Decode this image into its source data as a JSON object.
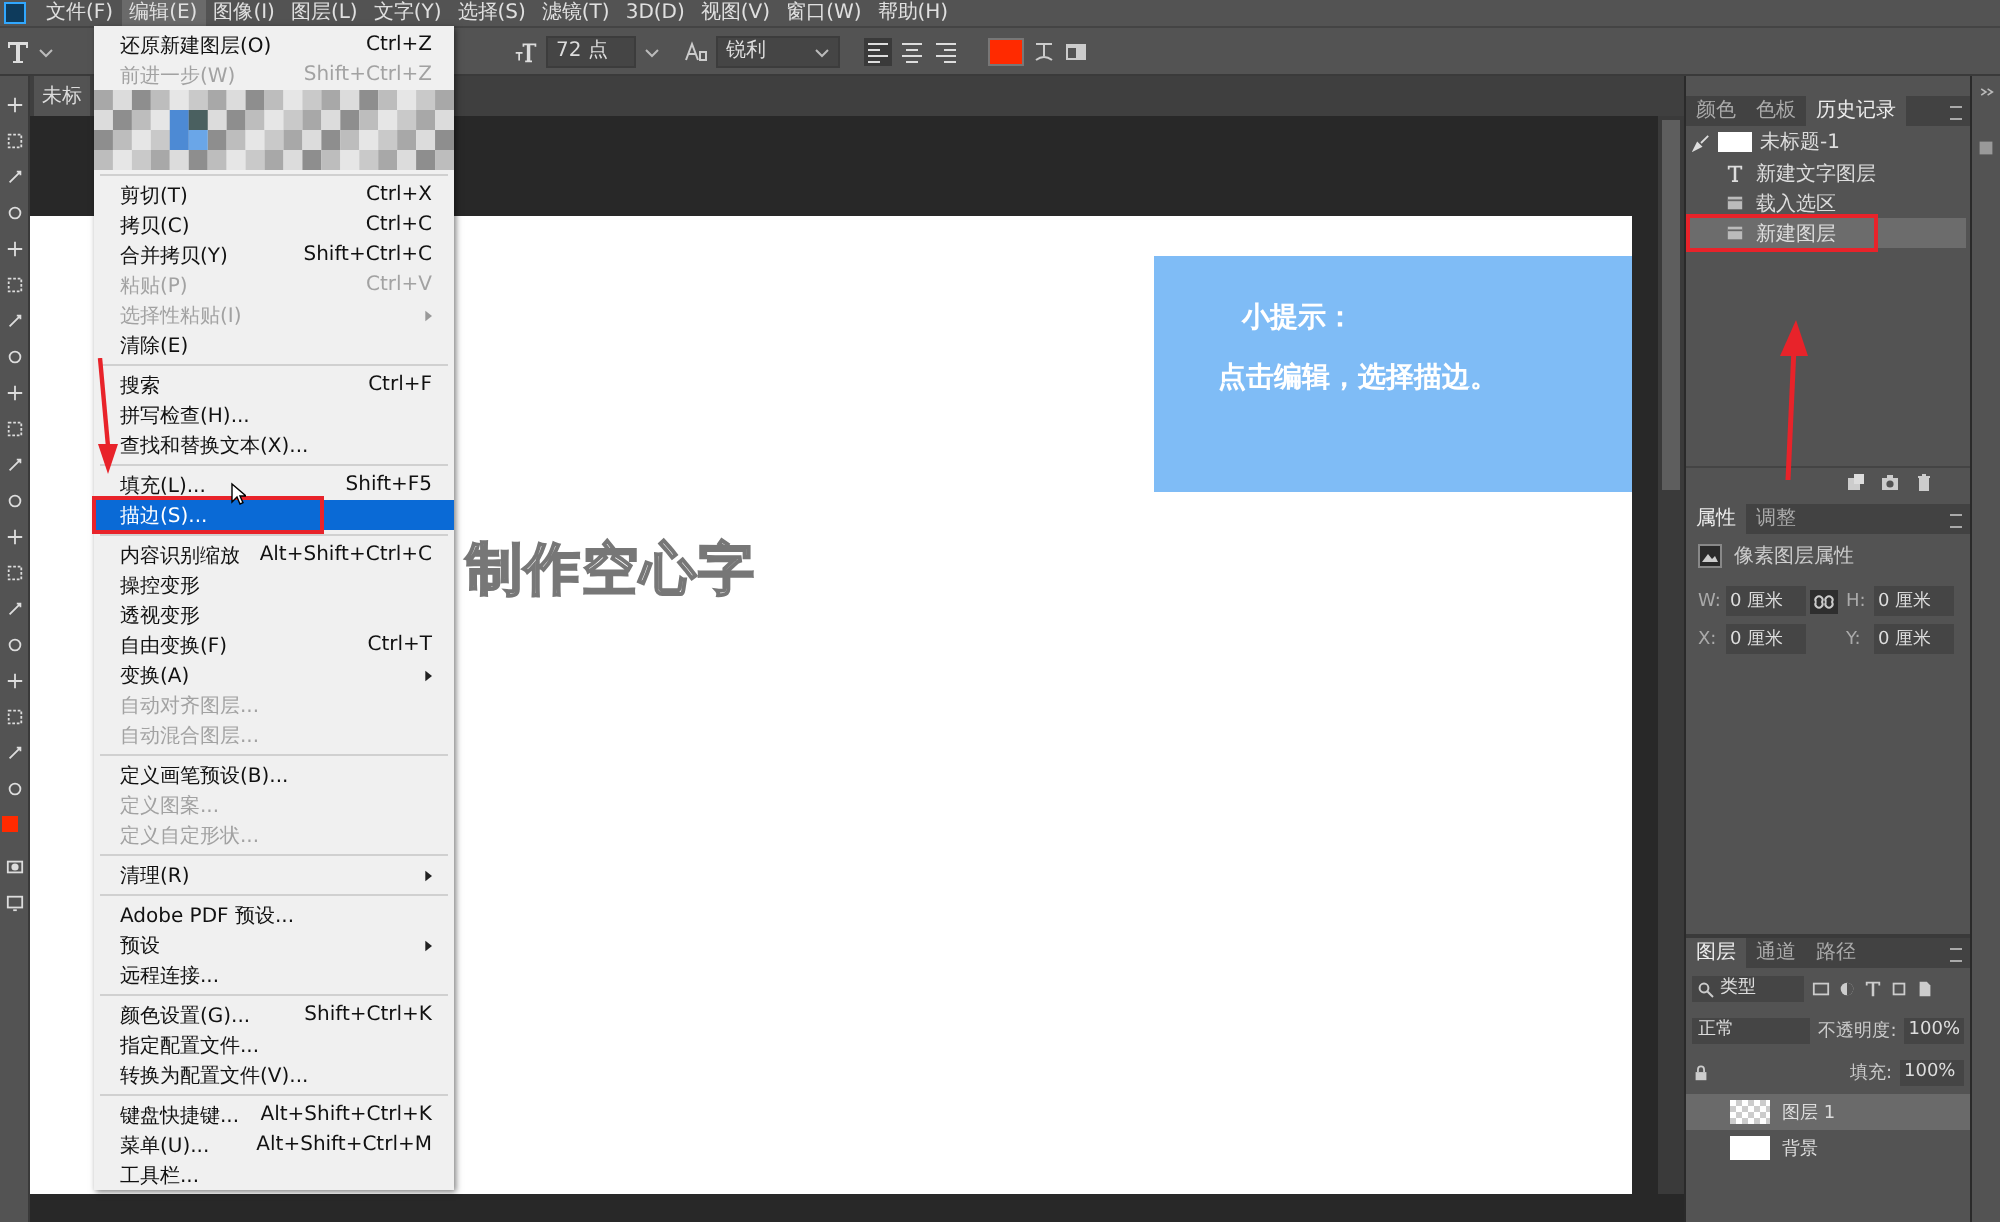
{
  "menubar": [
    {
      "label": "文件(F)",
      "selected": false
    },
    {
      "label": "编辑(E)",
      "selected": true
    },
    {
      "label": "图像(I)",
      "selected": false
    },
    {
      "label": "图层(L)",
      "selected": false
    },
    {
      "label": "文字(Y)",
      "selected": false
    },
    {
      "label": "选择(S)",
      "selected": false
    },
    {
      "label": "滤镜(T)",
      "selected": false
    },
    {
      "label": "3D(D)",
      "selected": false
    },
    {
      "label": "视图(V)",
      "selected": false
    },
    {
      "label": "窗口(W)",
      "selected": false
    },
    {
      "label": "帮助(H)",
      "selected": false
    }
  ],
  "options_bar": {
    "font_size": "72 点",
    "antialias": "锐利"
  },
  "document_tab": {
    "title": "未标"
  },
  "edit_menu": [
    {
      "kind": "item",
      "label": "还原新建图层(O)",
      "shortcut": "Ctrl+Z",
      "disabled": false,
      "selected": false,
      "submenu": false,
      "annotated": false
    },
    {
      "kind": "item",
      "label": "前进一步(W)",
      "shortcut": "Shift+Ctrl+Z",
      "disabled": true,
      "selected": false,
      "submenu": false,
      "annotated": false
    },
    {
      "kind": "blurred"
    },
    {
      "kind": "separator"
    },
    {
      "kind": "item",
      "label": "剪切(T)",
      "shortcut": "Ctrl+X",
      "disabled": false,
      "selected": false,
      "submenu": false,
      "annotated": false
    },
    {
      "kind": "item",
      "label": "拷贝(C)",
      "shortcut": "Ctrl+C",
      "disabled": false,
      "selected": false,
      "submenu": false,
      "annotated": false
    },
    {
      "kind": "item",
      "label": "合并拷贝(Y)",
      "shortcut": "Shift+Ctrl+C",
      "disabled": false,
      "selected": false,
      "submenu": false,
      "annotated": false
    },
    {
      "kind": "item",
      "label": "粘贴(P)",
      "shortcut": "Ctrl+V",
      "disabled": true,
      "selected": false,
      "submenu": false,
      "annotated": false
    },
    {
      "kind": "item",
      "label": "选择性粘贴(I)",
      "disabled": true,
      "selected": false,
      "submenu": true,
      "annotated": false
    },
    {
      "kind": "item",
      "label": "清除(E)",
      "disabled": false,
      "selected": false,
      "submenu": false,
      "annotated": false
    },
    {
      "kind": "separator"
    },
    {
      "kind": "item",
      "label": "搜索",
      "shortcut": "Ctrl+F",
      "disabled": false,
      "selected": false,
      "submenu": false,
      "annotated": false
    },
    {
      "kind": "item",
      "label": "拼写检查(H)...",
      "disabled": false,
      "selected": false,
      "submenu": false,
      "annotated": false
    },
    {
      "kind": "item",
      "label": "查找和替换文本(X)...",
      "disabled": false,
      "selected": false,
      "submenu": false,
      "annotated": false
    },
    {
      "kind": "separator"
    },
    {
      "kind": "item",
      "label": "填充(L)...",
      "shortcut": "Shift+F5",
      "disabled": false,
      "selected": false,
      "submenu": false,
      "annotated": false
    },
    {
      "kind": "item",
      "label": "描边(S)...",
      "disabled": false,
      "selected": true,
      "submenu": false,
      "annotated": true
    },
    {
      "kind": "separator"
    },
    {
      "kind": "item",
      "label": "内容识别缩放",
      "shortcut": "Alt+Shift+Ctrl+C",
      "disabled": false,
      "selected": false,
      "submenu": false,
      "annotated": false
    },
    {
      "kind": "item",
      "label": "操控变形",
      "disabled": false,
      "selected": false,
      "submenu": false,
      "annotated": false
    },
    {
      "kind": "item",
      "label": "透视变形",
      "disabled": false,
      "selected": false,
      "submenu": false,
      "annotated": false
    },
    {
      "kind": "item",
      "label": "自由变换(F)",
      "shortcut": "Ctrl+T",
      "disabled": false,
      "selected": false,
      "submenu": false,
      "annotated": false
    },
    {
      "kind": "item",
      "label": "变换(A)",
      "disabled": false,
      "selected": false,
      "submenu": true,
      "annotated": false
    },
    {
      "kind": "item",
      "label": "自动对齐图层...",
      "disabled": true,
      "selected": false,
      "submenu": false,
      "annotated": false
    },
    {
      "kind": "item",
      "label": "自动混合图层...",
      "disabled": true,
      "selected": false,
      "submenu": false,
      "annotated": false
    },
    {
      "kind": "separator"
    },
    {
      "kind": "item",
      "label": "定义画笔预设(B)...",
      "disabled": false,
      "selected": false,
      "submenu": false,
      "annotated": false
    },
    {
      "kind": "item",
      "label": "定义图案...",
      "disabled": true,
      "selected": false,
      "submenu": false,
      "annotated": false
    },
    {
      "kind": "item",
      "label": "定义自定形状...",
      "disabled": true,
      "selected": false,
      "submenu": false,
      "annotated": false
    },
    {
      "kind": "separator"
    },
    {
      "kind": "item",
      "label": "清理(R)",
      "disabled": false,
      "selected": false,
      "submenu": true,
      "annotated": false
    },
    {
      "kind": "separator"
    },
    {
      "kind": "item",
      "label": "Adobe PDF 预设...",
      "disabled": false,
      "selected": false,
      "submenu": false,
      "annotated": false
    },
    {
      "kind": "item",
      "label": "预设",
      "disabled": false,
      "selected": false,
      "submenu": true,
      "annotated": false
    },
    {
      "kind": "item",
      "label": "远程连接...",
      "disabled": false,
      "selected": false,
      "submenu": false,
      "annotated": false
    },
    {
      "kind": "separator"
    },
    {
      "kind": "item",
      "label": "颜色设置(G)...",
      "shortcut": "Shift+Ctrl+K",
      "disabled": false,
      "selected": false,
      "submenu": false,
      "annotated": false
    },
    {
      "kind": "item",
      "label": "指定配置文件...",
      "disabled": false,
      "selected": false,
      "submenu": false,
      "annotated": false
    },
    {
      "kind": "item",
      "label": "转换为配置文件(V)...",
      "disabled": false,
      "selected": false,
      "submenu": false,
      "annotated": false
    },
    {
      "kind": "separator"
    },
    {
      "kind": "item",
      "label": "键盘快捷键...",
      "shortcut": "Alt+Shift+Ctrl+K",
      "disabled": false,
      "selected": false,
      "submenu": false,
      "annotated": false
    },
    {
      "kind": "item",
      "label": "菜单(U)...",
      "shortcut": "Alt+Shift+Ctrl+M",
      "disabled": false,
      "selected": false,
      "submenu": false,
      "annotated": false
    },
    {
      "kind": "item",
      "label": "工具栏...",
      "disabled": false,
      "selected": false,
      "submenu": false,
      "annotated": false
    }
  ],
  "canvas": {
    "outline_text": "制作空心字",
    "tip": {
      "title": "小提示：",
      "body": "点击编辑，选择描边。"
    }
  },
  "history_panel": {
    "tabs": [
      {
        "label": "颜色",
        "selected": false
      },
      {
        "label": "色板",
        "selected": false
      },
      {
        "label": "历史记录",
        "selected": true
      }
    ],
    "snapshot": "未标题-1",
    "steps": [
      {
        "kind": "text",
        "label": "新建文字图层",
        "selected": false,
        "annotated": false
      },
      {
        "kind": "layer",
        "label": "载入选区",
        "selected": false,
        "annotated": false
      },
      {
        "kind": "layer",
        "label": "新建图层",
        "selected": true,
        "annotated": true
      }
    ]
  },
  "properties_panel": {
    "tabs": [
      {
        "label": "属性",
        "selected": true
      },
      {
        "label": "调整",
        "selected": false
      }
    ],
    "title": "像素图层属性",
    "fields": [
      {
        "label": "W:",
        "value": "0 厘米"
      },
      {
        "label": "H:",
        "value": "0 厘米"
      },
      {
        "label": "X:",
        "value": "0 厘米"
      },
      {
        "label": "Y:",
        "value": "0 厘米"
      }
    ]
  },
  "layers_panel": {
    "tabs": [
      {
        "label": "图层",
        "selected": true
      },
      {
        "label": "通道",
        "selected": false
      },
      {
        "label": "路径",
        "selected": false
      }
    ],
    "filter": "类型",
    "blend_mode": "正常",
    "opacity_label": "不透明度:",
    "opacity": "100%",
    "fill_label": "填充:",
    "fill": "100%",
    "layers": [
      {
        "name": "图层 1",
        "selected": true
      },
      {
        "name": "背景",
        "selected": false
      }
    ]
  }
}
